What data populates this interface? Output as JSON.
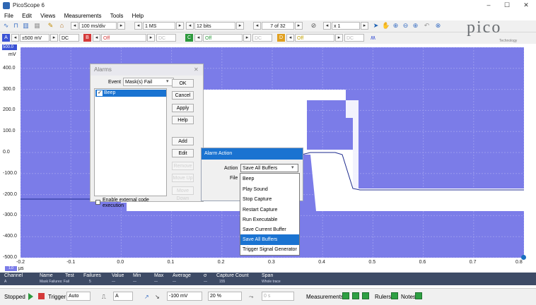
{
  "window": {
    "title": "PicoScope 6",
    "controls": [
      "–",
      "☐",
      "✕"
    ]
  },
  "menu": [
    "File",
    "Edit",
    "Views",
    "Measurements",
    "Tools",
    "Help"
  ],
  "toolbar1": {
    "timebase": "100 ms/div",
    "samples": "1 MS",
    "resolution": "12 bits",
    "capture_index": "7 of 32",
    "zoom": "x 1"
  },
  "toolbar2": {
    "channel_a": "A",
    "range_a": "±500 mV",
    "coupling_a": "DC",
    "channel_b": "B",
    "range_b": "Off",
    "coupling_b": "DC",
    "channel_c": "C",
    "range_c": "Off",
    "coupling_c": "DC",
    "channel_d": "D",
    "range_d": "Off",
    "coupling_d": "DC"
  },
  "logo": {
    "text": "pico",
    "subtitle": "Technology"
  },
  "plot": {
    "y_unit": "mV",
    "y_ticks": [
      "500.0",
      "400.0",
      "300.0",
      "200.0",
      "100.0",
      "0.0",
      "-100.0",
      "-200.0",
      "-300.0",
      "-400.0",
      "-500.0"
    ],
    "x_ticks": [
      "-0.2",
      "-0.1",
      "0.0",
      "0.1",
      "0.2",
      "0.3",
      "0.4",
      "0.5",
      "0.6",
      "0.7",
      "0.8"
    ],
    "x_unit_box": "1.0",
    "x_unit": "µs",
    "colors": {
      "background": "#7b7ce8",
      "mask": "#ffffff",
      "trace": "#1c2a8c"
    }
  },
  "alarms_dialog": {
    "title": "Alarms",
    "event_label": "Event",
    "event_value": "Mask(s) Fail",
    "list_items": [
      {
        "label": "Beep",
        "checked": true,
        "selected": true
      }
    ],
    "buttons": {
      "ok": "OK",
      "cancel": "Cancel",
      "apply": "Apply",
      "help": "Help",
      "add": "Add",
      "edit": "Edit",
      "remove": "Remove",
      "move_up": "Move Up",
      "move_down": "Move Down"
    },
    "external_code_label": "Enable external code execution"
  },
  "alarm_action": {
    "title": "Alarm Action",
    "action_label": "Action",
    "action_value": "Save All Buffers",
    "file_label": "File",
    "options": [
      "Beep",
      "Play Sound",
      "Stop Capture",
      "Restart Capture",
      "Run Executable",
      "Save Current Buffer",
      "Save All Buffers",
      "Trigger Signal Generator"
    ],
    "highlighted": "Save All Buffers"
  },
  "measurements": {
    "headers": [
      "Channel",
      "Name",
      "Test",
      "Failures",
      "Value",
      "Min",
      "Max",
      "Average",
      "σ",
      "Capture Count",
      "Span"
    ],
    "row": [
      "A",
      "Mask Failures: Fail",
      "",
      "5",
      "—",
      "—",
      "—",
      "—",
      "—",
      "155",
      "Whole trace"
    ]
  },
  "statusbar": {
    "status": "Stopped",
    "trigger_label": "Trigger",
    "trigger_mode": "Auto",
    "trigger_channel": "A",
    "trigger_level": "-100 mV",
    "pre_trigger": "20 %",
    "delay": "0 s",
    "measurements_label": "Measurements",
    "rulers_label": "Rulers",
    "notes_label": "Notes"
  }
}
